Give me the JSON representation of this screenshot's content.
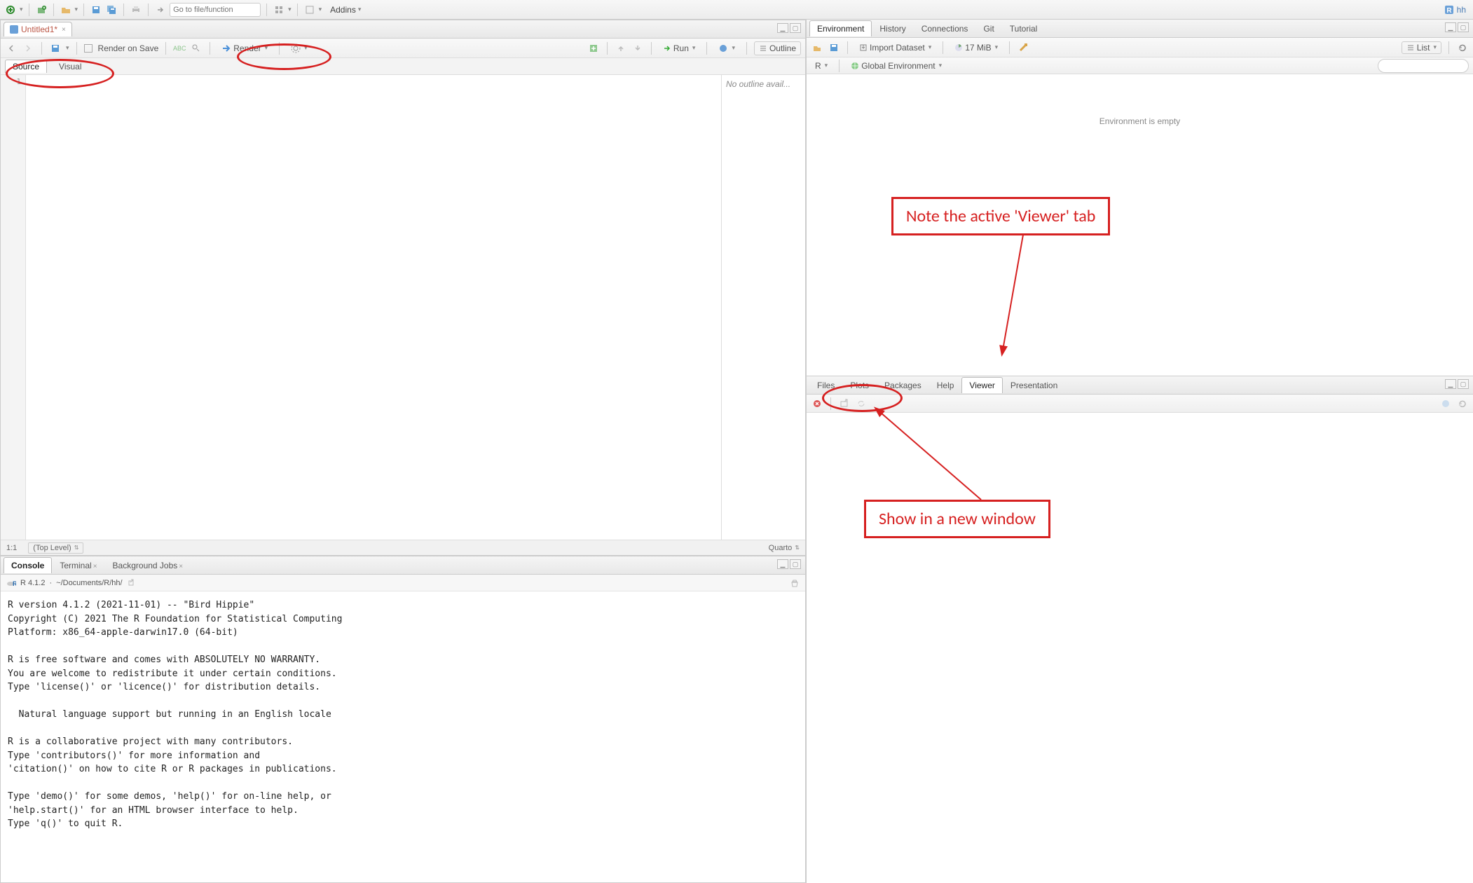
{
  "topToolbar": {
    "goto_placeholder": "Go to file/function",
    "addins_label": "Addins",
    "project_label": "hh"
  },
  "sourcePane": {
    "file_tab": "Untitled1*",
    "renderOnSave_label": "Render on Save",
    "render_btn_label": "Render",
    "run_btn_label": "Run",
    "outline_btn_label": "Outline",
    "mode_tabs": {
      "source": "Source",
      "visual": "Visual"
    },
    "line_numbers": [
      "1"
    ],
    "outline_empty": "No outline avail...",
    "status_pos": "1:1",
    "status_scope": "(Top Level)",
    "status_right": "Quarto"
  },
  "consolePane": {
    "tabs": {
      "console": "Console",
      "terminal": "Terminal",
      "bgjobs": "Background Jobs"
    },
    "r_version_short": "R 4.1.2",
    "wd_path": "~/Documents/R/hh/",
    "body": "R version 4.1.2 (2021-11-01) -- \"Bird Hippie\"\nCopyright (C) 2021 The R Foundation for Statistical Computing\nPlatform: x86_64-apple-darwin17.0 (64-bit)\n\nR is free software and comes with ABSOLUTELY NO WARRANTY.\nYou are welcome to redistribute it under certain conditions.\nType 'license()' or 'licence()' for distribution details.\n\n  Natural language support but running in an English locale\n\nR is a collaborative project with many contributors.\nType 'contributors()' for more information and\n'citation()' on how to cite R or R packages in publications.\n\nType 'demo()' for some demos, 'help()' for on-line help, or\n'help.start()' for an HTML browser interface to help.\nType 'q()' to quit R.\n"
  },
  "envPane": {
    "tabs": {
      "environment": "Environment",
      "history": "History",
      "connections": "Connections",
      "git": "Git",
      "tutorial": "Tutorial"
    },
    "import_label": "Import Dataset",
    "mem_label": "17 MiB",
    "list_label": "List",
    "scope_r": "R",
    "scope_env": "Global Environment",
    "empty_msg": "Environment is empty",
    "search_placeholder": ""
  },
  "viewerPane": {
    "tabs": {
      "files": "Files",
      "plots": "Plots",
      "packages": "Packages",
      "help": "Help",
      "viewer": "Viewer",
      "presentation": "Presentation"
    }
  },
  "annotations": {
    "box1": "Note the active 'Viewer' tab",
    "box2": "Show in a new window"
  }
}
